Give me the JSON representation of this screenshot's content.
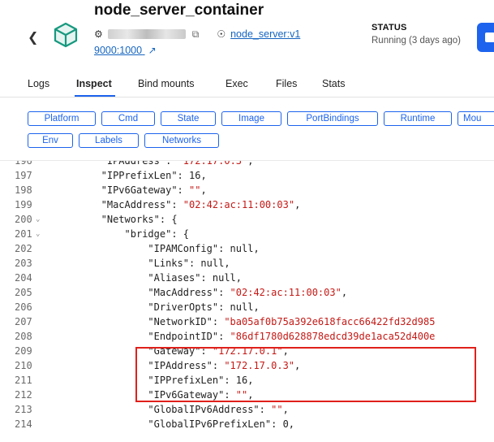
{
  "header": {
    "title": "node_server_container",
    "image_link": "node_server:v1",
    "ports": "9000:1000",
    "status_label": "STATUS",
    "status_value": "Running (3 days ago)"
  },
  "tabs": [
    {
      "label": "Logs"
    },
    {
      "label": "Inspect"
    },
    {
      "label": "Bind mounts"
    },
    {
      "label": "Exec"
    },
    {
      "label": "Files"
    },
    {
      "label": "Stats"
    }
  ],
  "filters": [
    {
      "label": "Platform"
    },
    {
      "label": "Cmd"
    },
    {
      "label": "State"
    },
    {
      "label": "Image"
    },
    {
      "label": "PortBindings"
    },
    {
      "label": "Runtime"
    },
    {
      "label": "Mou"
    },
    {
      "label": "Env"
    },
    {
      "label": "Labels"
    },
    {
      "label": "Networks"
    }
  ],
  "code_lines": [
    {
      "num": "196",
      "indent": 12,
      "key": "\"IPAddress\"",
      "sep": ": ",
      "val": "\"172.17.0.3\"",
      "tail": ",",
      "fold": false
    },
    {
      "num": "197",
      "indent": 12,
      "key": "\"IPPrefixLen\"",
      "sep": ": ",
      "val": "16",
      "tail": ",",
      "fold": false
    },
    {
      "num": "198",
      "indent": 12,
      "key": "\"IPv6Gateway\"",
      "sep": ": ",
      "val": "\"\"",
      "tail": ",",
      "fold": false
    },
    {
      "num": "199",
      "indent": 12,
      "key": "\"MacAddress\"",
      "sep": ": ",
      "val": "\"02:42:ac:11:00:03\"",
      "tail": ",",
      "fold": false
    },
    {
      "num": "200",
      "indent": 12,
      "key": "\"Networks\"",
      "sep": ": ",
      "val": "",
      "tail": "{",
      "fold": true
    },
    {
      "num": "201",
      "indent": 16,
      "key": "\"bridge\"",
      "sep": ": ",
      "val": "",
      "tail": "{",
      "fold": true
    },
    {
      "num": "202",
      "indent": 20,
      "key": "\"IPAMConfig\"",
      "sep": ": ",
      "val": "null",
      "tail": ",",
      "fold": false
    },
    {
      "num": "203",
      "indent": 20,
      "key": "\"Links\"",
      "sep": ": ",
      "val": "null",
      "tail": ",",
      "fold": false
    },
    {
      "num": "204",
      "indent": 20,
      "key": "\"Aliases\"",
      "sep": ": ",
      "val": "null",
      "tail": ",",
      "fold": false
    },
    {
      "num": "205",
      "indent": 20,
      "key": "\"MacAddress\"",
      "sep": ": ",
      "val": "\"02:42:ac:11:00:03\"",
      "tail": ",",
      "fold": false
    },
    {
      "num": "206",
      "indent": 20,
      "key": "\"DriverOpts\"",
      "sep": ": ",
      "val": "null",
      "tail": ",",
      "fold": false
    },
    {
      "num": "207",
      "indent": 20,
      "key": "\"NetworkID\"",
      "sep": ": ",
      "val": "\"ba05af0b75a392e618facc66422fd32d985",
      "tail": "",
      "fold": false
    },
    {
      "num": "208",
      "indent": 20,
      "key": "\"EndpointID\"",
      "sep": ": ",
      "val": "\"86df1780d628878edcd39de1aca52d400e",
      "tail": "",
      "fold": false
    },
    {
      "num": "209",
      "indent": 20,
      "key": "\"Gateway\"",
      "sep": ": ",
      "val": "\"172.17.0.1\"",
      "tail": ",",
      "fold": false
    },
    {
      "num": "210",
      "indent": 20,
      "key": "\"IPAddress\"",
      "sep": ": ",
      "val": "\"172.17.0.3\"",
      "tail": ",",
      "fold": false
    },
    {
      "num": "211",
      "indent": 20,
      "key": "\"IPPrefixLen\"",
      "sep": ": ",
      "val": "16",
      "tail": ",",
      "fold": false
    },
    {
      "num": "212",
      "indent": 20,
      "key": "\"IPv6Gateway\"",
      "sep": ": ",
      "val": "\"\"",
      "tail": ",",
      "fold": false
    },
    {
      "num": "213",
      "indent": 20,
      "key": "\"GlobalIPv6Address\"",
      "sep": ": ",
      "val": "\"\"",
      "tail": ",",
      "fold": false
    },
    {
      "num": "214",
      "indent": 20,
      "key": "\"GlobalIPv6PrefixLen\"",
      "sep": ": ",
      "val": "0",
      "tail": ",",
      "fold": false
    }
  ],
  "colors": {
    "accent": "#1d63ed",
    "string": "#c41a16",
    "highlight_box": "#e0201b"
  }
}
